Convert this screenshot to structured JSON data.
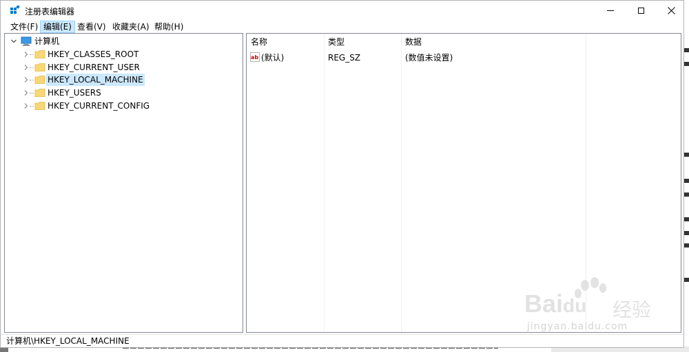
{
  "window": {
    "title": "注册表编辑器"
  },
  "menu": [
    {
      "label": "文件(F)"
    },
    {
      "label": "编辑(E)",
      "selected": true
    },
    {
      "label": "查看(V)"
    },
    {
      "label": "收藏夹(A)"
    },
    {
      "label": "帮助(H)"
    }
  ],
  "tree": {
    "root": {
      "label": "计算机",
      "icon": "computer-icon",
      "expanded": true
    },
    "children": [
      {
        "label": "HKEY_CLASSES_ROOT",
        "icon": "folder-icon"
      },
      {
        "label": "HKEY_CURRENT_USER",
        "icon": "folder-icon"
      },
      {
        "label": "HKEY_LOCAL_MACHINE",
        "icon": "folder-icon",
        "selected": true
      },
      {
        "label": "HKEY_USERS",
        "icon": "folder-icon"
      },
      {
        "label": "HKEY_CURRENT_CONFIG",
        "icon": "folder-icon"
      }
    ]
  },
  "values": {
    "columns": [
      "名称",
      "类型",
      "数据"
    ],
    "rows": [
      {
        "name": "(默认)",
        "type": "REG_SZ",
        "data": "(数值未设置)",
        "icon": "string-value-icon"
      }
    ]
  },
  "status": {
    "path": "计算机\\HKEY_LOCAL_MACHINE"
  },
  "watermark": {
    "brand": "Bai",
    "brand2": "du",
    "product": "经验",
    "url": "jingyan.baidu.com"
  },
  "colors": {
    "selection": "#cce8ff",
    "folder": "#f8d775",
    "accent": "#0078d7"
  }
}
